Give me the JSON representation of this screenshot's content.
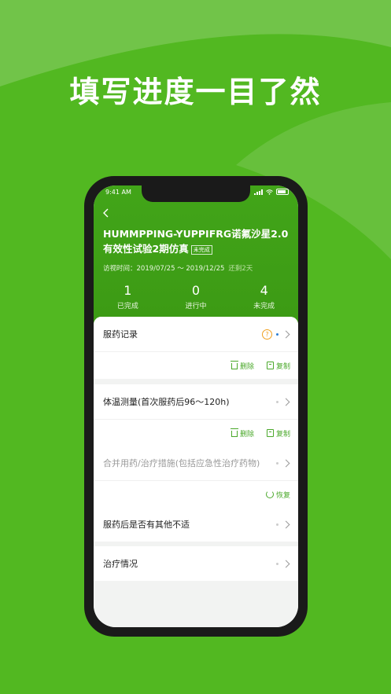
{
  "headline": "填写进度一目了然",
  "status": {
    "time": "9:41 AM"
  },
  "header": {
    "back_icon": "chevron-left-icon",
    "title": "HUMMPPING-YUPPIFRG诺氟沙星2.0有效性试验2期仿真",
    "tag": "未完成",
    "visit_label": "访视时间：2019/07/25 ～ 2019/12/25",
    "visit_remaining": "还剩2天"
  },
  "stats": [
    {
      "num": "1",
      "label": "已完成"
    },
    {
      "num": "0",
      "label": "进行中"
    },
    {
      "num": "4",
      "label": "未完成"
    }
  ],
  "items": [
    {
      "label": "服药记录",
      "delete": "删除",
      "copy": "复制"
    },
    {
      "label": "体温测量(首次服药后96～120h)",
      "delete": "删除",
      "copy": "复制"
    },
    {
      "label": "合并用药/治疗措施(包括应急性治疗药物)",
      "restore": "恢复"
    },
    {
      "label": "服药后是否有其他不适"
    },
    {
      "label": "治疗情况"
    }
  ],
  "colors": {
    "brand": "#52b821",
    "header": "#3c9a14",
    "accent": "#4aa82a"
  }
}
